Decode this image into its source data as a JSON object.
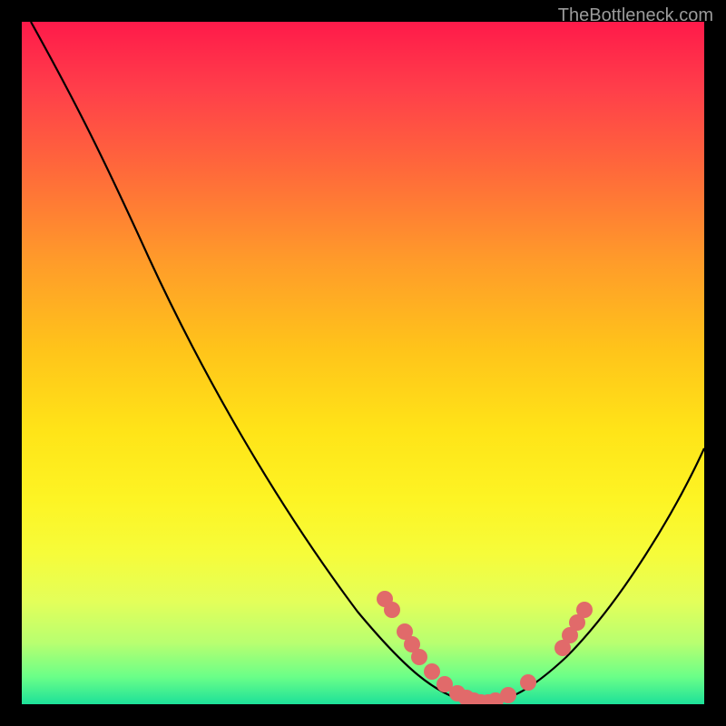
{
  "watermark": "TheBottleneck.com",
  "chart_data": {
    "type": "line",
    "title": "",
    "xlabel": "",
    "ylabel": "",
    "xlim": [
      0,
      100
    ],
    "ylim": [
      0,
      100
    ],
    "series": [
      {
        "name": "bottleneck-curve",
        "x": [
          0,
          5,
          10,
          15,
          20,
          25,
          30,
          35,
          40,
          45,
          50,
          53,
          56,
          58,
          60,
          62,
          64,
          66,
          68,
          70,
          72,
          75,
          78,
          82,
          86,
          90,
          94,
          98,
          100
        ],
        "y": [
          100,
          93,
          85,
          77,
          68,
          59,
          50,
          41,
          33,
          25,
          18,
          14,
          10,
          7,
          5,
          3,
          2,
          1,
          0,
          0,
          1,
          3,
          6,
          11,
          18,
          25,
          33,
          41,
          45
        ]
      }
    ],
    "scatter_points": {
      "name": "highlighted-points",
      "x": [
        53,
        54,
        56,
        57,
        58,
        60,
        62,
        64,
        65,
        66,
        67,
        68,
        69,
        71,
        74,
        79,
        80,
        81,
        82
      ],
      "y": [
        15,
        14,
        11,
        9,
        7,
        5,
        3,
        2,
        1,
        1,
        0,
        0,
        0,
        1,
        3,
        8,
        10,
        12,
        14
      ]
    },
    "gradient_bands": [
      {
        "color": "#ff1a4a",
        "position": 0
      },
      {
        "color": "#ffe418",
        "position": 60
      },
      {
        "color": "#1de199",
        "position": 100
      }
    ]
  }
}
